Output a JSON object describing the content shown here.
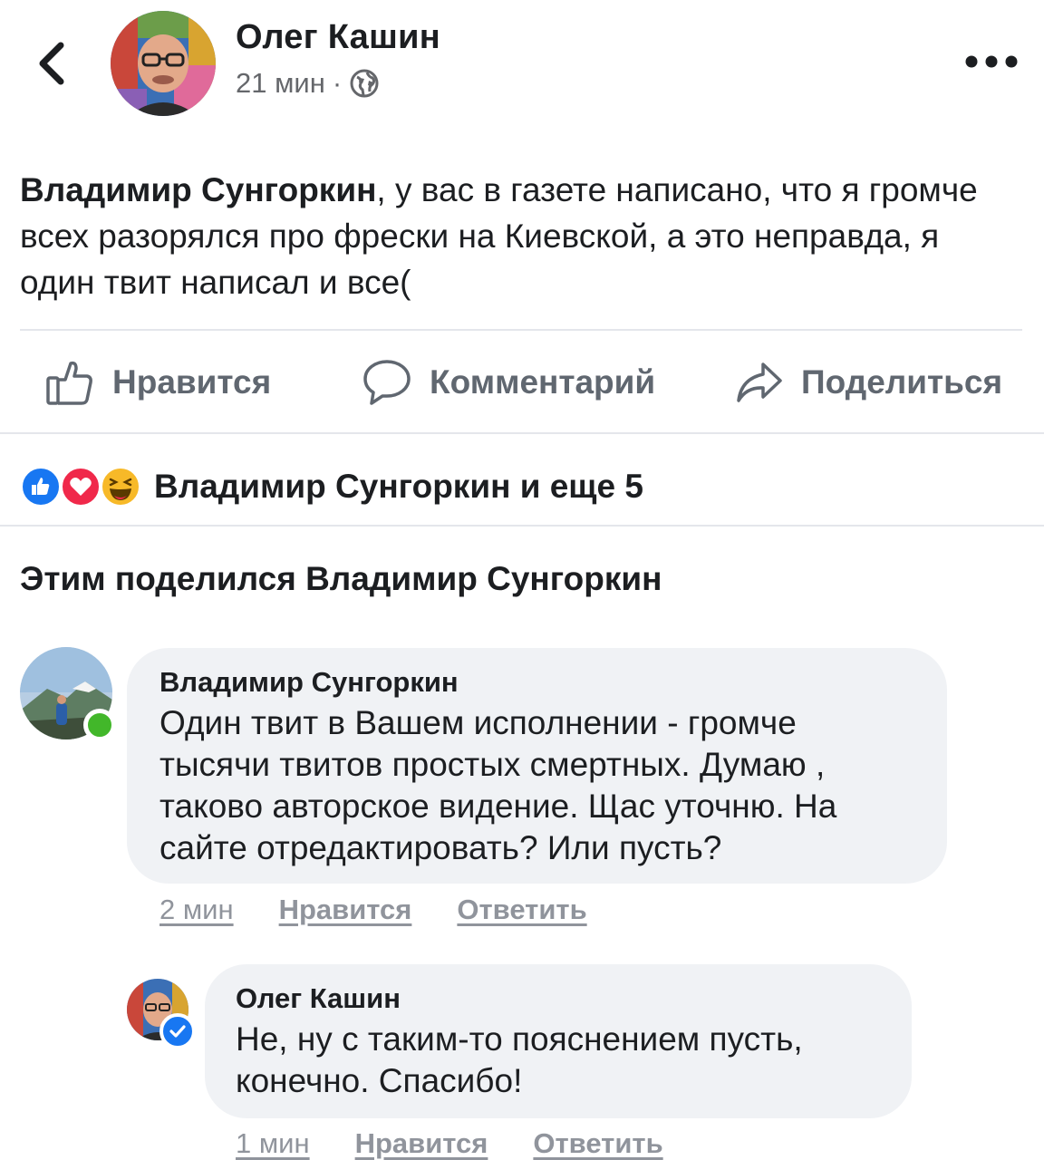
{
  "post": {
    "author": "Олег Кашин",
    "time": "21 мин",
    "separator": "·",
    "mention": "Владимир Сунгоркин",
    "text_after_mention": ", у вас в газете написано, что я громче всех разорялся про фрески на Киевской, а это неправда, я один твит написал и все("
  },
  "actions": {
    "like": "Нравится",
    "comment": "Комментарий",
    "share": "Поделиться"
  },
  "reactions": {
    "summary": "Владимир Сунгоркин и еще 5",
    "icons": [
      "like-reaction-icon",
      "love-reaction-icon",
      "haha-reaction-icon"
    ],
    "colors": {
      "like": "#1877f2",
      "love": "#f0284a",
      "haha": "#f7b928"
    }
  },
  "shared_by": "Этим поделился Владимир Сунгоркин",
  "comments": [
    {
      "author": "Владимир Сунгоркин",
      "text": "Один твит в Вашем исполнении - громче тысячи твитов  простых смертных. Думаю , таково авторское видение. Щас уточню. На сайте отредактировать? Или пусть?",
      "time": "2 мин",
      "like_label": "Нравится",
      "reply_label": "Ответить",
      "online": true
    },
    {
      "author": "Олег Кашин",
      "text": "Не, ну с таким-то пояснением пусть, конечно. Спасибо!",
      "time": "1 мин",
      "like_label": "Нравится",
      "reply_label": "Ответить",
      "verified": true
    }
  ]
}
